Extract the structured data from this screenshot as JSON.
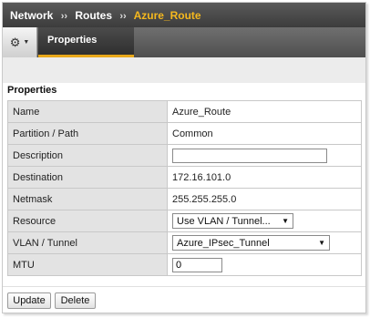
{
  "breadcrumb": {
    "items": [
      "Network",
      "Routes"
    ],
    "separator": "››",
    "current": "Azure_Route"
  },
  "toolbar": {
    "gear_icon": "gear-icon",
    "tab_properties": "Properties"
  },
  "section": {
    "title": "Properties"
  },
  "fields": {
    "name": {
      "label": "Name",
      "value": "Azure_Route"
    },
    "partition": {
      "label": "Partition / Path",
      "value": "Common"
    },
    "description": {
      "label": "Description",
      "value": ""
    },
    "destination": {
      "label": "Destination",
      "value": "172.16.101.0"
    },
    "netmask": {
      "label": "Netmask",
      "value": "255.255.255.0"
    },
    "resource": {
      "label": "Resource",
      "value": "Use VLAN / Tunnel..."
    },
    "vlan": {
      "label": "VLAN / Tunnel",
      "value": "Azure_IPsec_Tunnel"
    },
    "mtu": {
      "label": "MTU",
      "value": "0"
    }
  },
  "buttons": {
    "update": "Update",
    "delete": "Delete"
  },
  "colors": {
    "accent": "#f5b81e",
    "tab_underline": "#e8a81a"
  }
}
